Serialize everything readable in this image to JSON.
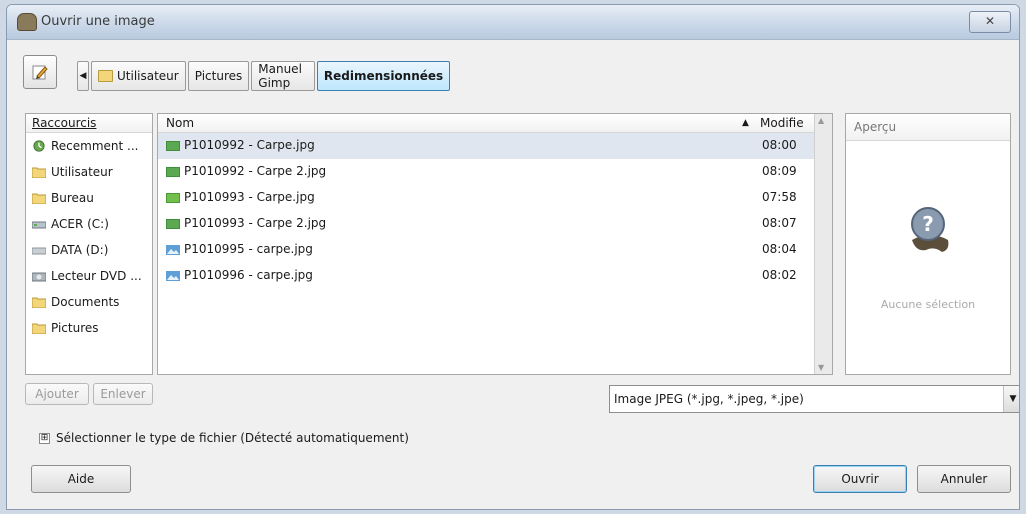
{
  "window": {
    "title": "Ouvrir une image",
    "close_label": "✕"
  },
  "breadcrumb": {
    "back_arrow": "◀",
    "items": [
      "Utilisateur",
      "Pictures",
      "Manuel Gimp",
      "Redimensionnées"
    ]
  },
  "places": {
    "header": "Raccourcis",
    "items": [
      {
        "label": "Recemment ...",
        "icon": "recent-icon"
      },
      {
        "label": "Utilisateur",
        "icon": "folder-icon"
      },
      {
        "label": "Bureau",
        "icon": "folder-icon"
      },
      {
        "label": "ACER (C:)",
        "icon": "drive-icon"
      },
      {
        "label": "DATA (D:)",
        "icon": "drive-icon"
      },
      {
        "label": "Lecteur DVD ...",
        "icon": "dvd-icon"
      },
      {
        "label": "Documents",
        "icon": "folder-icon"
      },
      {
        "label": "Pictures",
        "icon": "folder-icon"
      }
    ],
    "add_label": "Ajouter",
    "remove_label": "Enlever"
  },
  "files": {
    "col_name": "Nom",
    "sort_indicator": "▲",
    "col_modified": "Modifie",
    "rows": [
      {
        "name": "P1010992 - Carpe.jpg",
        "time": "08:00",
        "icon": "image-green-icon"
      },
      {
        "name": "P1010992 - Carpe 2.jpg",
        "time": "08:09",
        "icon": "image-green-icon"
      },
      {
        "name": "P1010993 - Carpe.jpg",
        "time": "07:58",
        "icon": "image-green-icon"
      },
      {
        "name": "P1010993 - Carpe 2.jpg",
        "time": "08:07",
        "icon": "image-green-icon"
      },
      {
        "name": "P1010995 - carpe.jpg",
        "time": "08:04",
        "icon": "image-blue-icon"
      },
      {
        "name": "P1010996 - carpe.jpg",
        "time": "08:02",
        "icon": "image-blue-icon"
      }
    ]
  },
  "preview": {
    "header": "Aperçu",
    "empty_text": "Aucune sélection"
  },
  "filter": {
    "selected": "Image JPEG (*.jpg, *.jpeg, *.jpe)",
    "arrow": "▼"
  },
  "expander": {
    "box": "⊞",
    "label": "Sélectionner le type de fichier (Détecté automatiquement)"
  },
  "buttons": {
    "help": "Aide",
    "open": "Ouvrir",
    "cancel": "Annuler"
  },
  "colors": {
    "accent": "#3c7fb1",
    "selection": "#dfe6ef"
  }
}
